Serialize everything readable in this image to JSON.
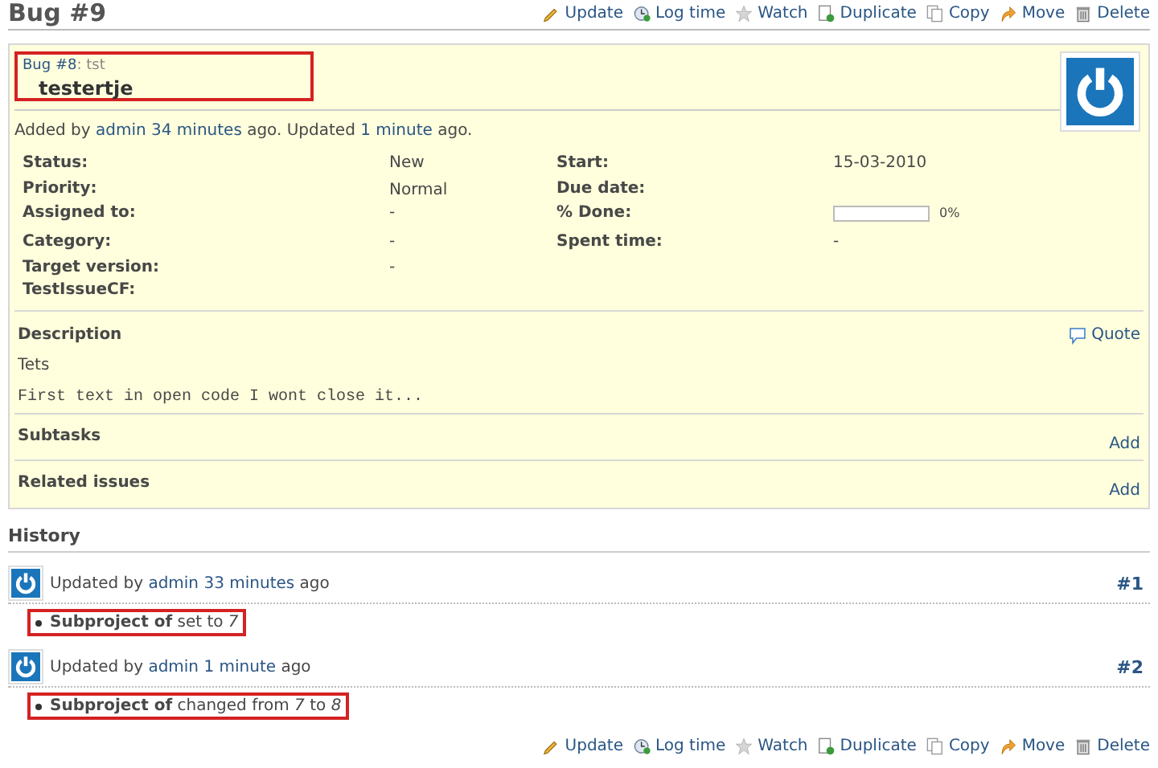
{
  "page_title": "Bug #9",
  "actions_top": [
    {
      "kind": "edit",
      "label": "Update"
    },
    {
      "kind": "time",
      "label": "Log time"
    },
    {
      "kind": "star",
      "label": "Watch"
    },
    {
      "kind": "duplicate",
      "label": "Duplicate"
    },
    {
      "kind": "copy",
      "label": "Copy"
    },
    {
      "kind": "move",
      "label": "Move"
    },
    {
      "kind": "delete",
      "label": "Delete"
    }
  ],
  "issue": {
    "parent_link": "Bug #8",
    "parent_subject": ": tst",
    "subject": "testertje",
    "highlighted": true,
    "added_by": {
      "prefix": "Added by ",
      "author": "admin",
      "added_ago": "34 minutes",
      "middle": " ago. Updated ",
      "updated_ago": "1 minute",
      "suffix": " ago."
    },
    "attributes": [
      {
        "label": "Status:",
        "value": "New",
        "label2": "Start:",
        "value2": "15-03-2010"
      },
      {
        "label": "Priority:",
        "value": "Normal",
        "label2": "Due date:"
      },
      {
        "label": "Assigned to:",
        "value": "-",
        "label2": "% Done:",
        "done": {
          "level": 0,
          "reading": "0%"
        }
      },
      {
        "label": "Category:",
        "value": "-",
        "label2": "Spent time:",
        "value2": "-"
      },
      {
        "label": "Target version:",
        "value": "-"
      },
      {
        "label": "TestIssueCF:"
      }
    ],
    "description": {
      "heading": "Description",
      "quote": "Quote",
      "text": "Tets",
      "code": "First text in open code I wont close it..."
    },
    "subtasks": {
      "heading": "Subtasks",
      "add": "Add"
    },
    "related": {
      "heading": "Related issues",
      "add": "Add"
    }
  },
  "history": {
    "heading": "History",
    "journals": [
      {
        "prefix": "Updated by ",
        "author": "admin",
        "ago": "33 minutes",
        "suffix": " ago",
        "number": "#1",
        "details": [
          {
            "text": "**Subproject of** set to *7*",
            "highlighted": true
          }
        ]
      },
      {
        "prefix": "Updated by ",
        "author": "admin",
        "ago": "1 minute",
        "suffix": " ago",
        "number": "#2",
        "details": [
          {
            "text": "**Subproject of** changed from *7* to *8*",
            "highlighted": true
          }
        ]
      }
    ]
  },
  "actions_bottom": [
    {
      "kind": "edit",
      "label": "Update"
    },
    {
      "kind": "time",
      "label": "Log time"
    },
    {
      "kind": "star",
      "label": "Watch"
    },
    {
      "kind": "duplicate",
      "label": "Duplicate"
    },
    {
      "kind": "copy",
      "label": "Copy"
    },
    {
      "kind": "move",
      "label": "Move"
    },
    {
      "kind": "delete",
      "label": "Delete"
    }
  ]
}
